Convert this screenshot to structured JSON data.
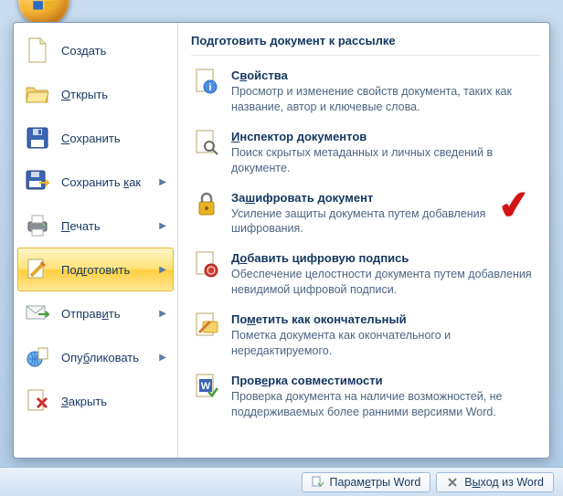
{
  "left": {
    "items": [
      {
        "label": "Создать"
      },
      {
        "label": "Открыть"
      },
      {
        "label": "Сохранить"
      },
      {
        "label": "Сохранить как"
      },
      {
        "label": "Печать"
      },
      {
        "label": "Подготовить"
      },
      {
        "label": "Отправить"
      },
      {
        "label": "Опубликовать"
      },
      {
        "label": "Закрыть"
      }
    ]
  },
  "right": {
    "header": "Подготовить документ к рассылке",
    "items": [
      {
        "title": "Свойства",
        "desc": "Просмотр и изменение свойств документа, таких как название, автор и ключевые слова."
      },
      {
        "title": "Инспектор документов",
        "desc": "Поиск скрытых метаданных и личных сведений в документе."
      },
      {
        "title": "Зашифровать документ",
        "desc": "Усиление защиты документа путем добавления шифрования."
      },
      {
        "title": "Добавить цифровую подпись",
        "desc": "Обеспечение целостности документа путем добавления невидимой цифровой подписи."
      },
      {
        "title": "Пометить как окончательный",
        "desc": "Пометка документа как окончательного и нередактируемого."
      },
      {
        "title": "Проверка совместимости",
        "desc": "Проверка документа на наличие возможностей, не поддерживаемых более ранними версиями Word."
      }
    ]
  },
  "footer": {
    "options": "Параметры Word",
    "exit": "Выход из Word"
  }
}
